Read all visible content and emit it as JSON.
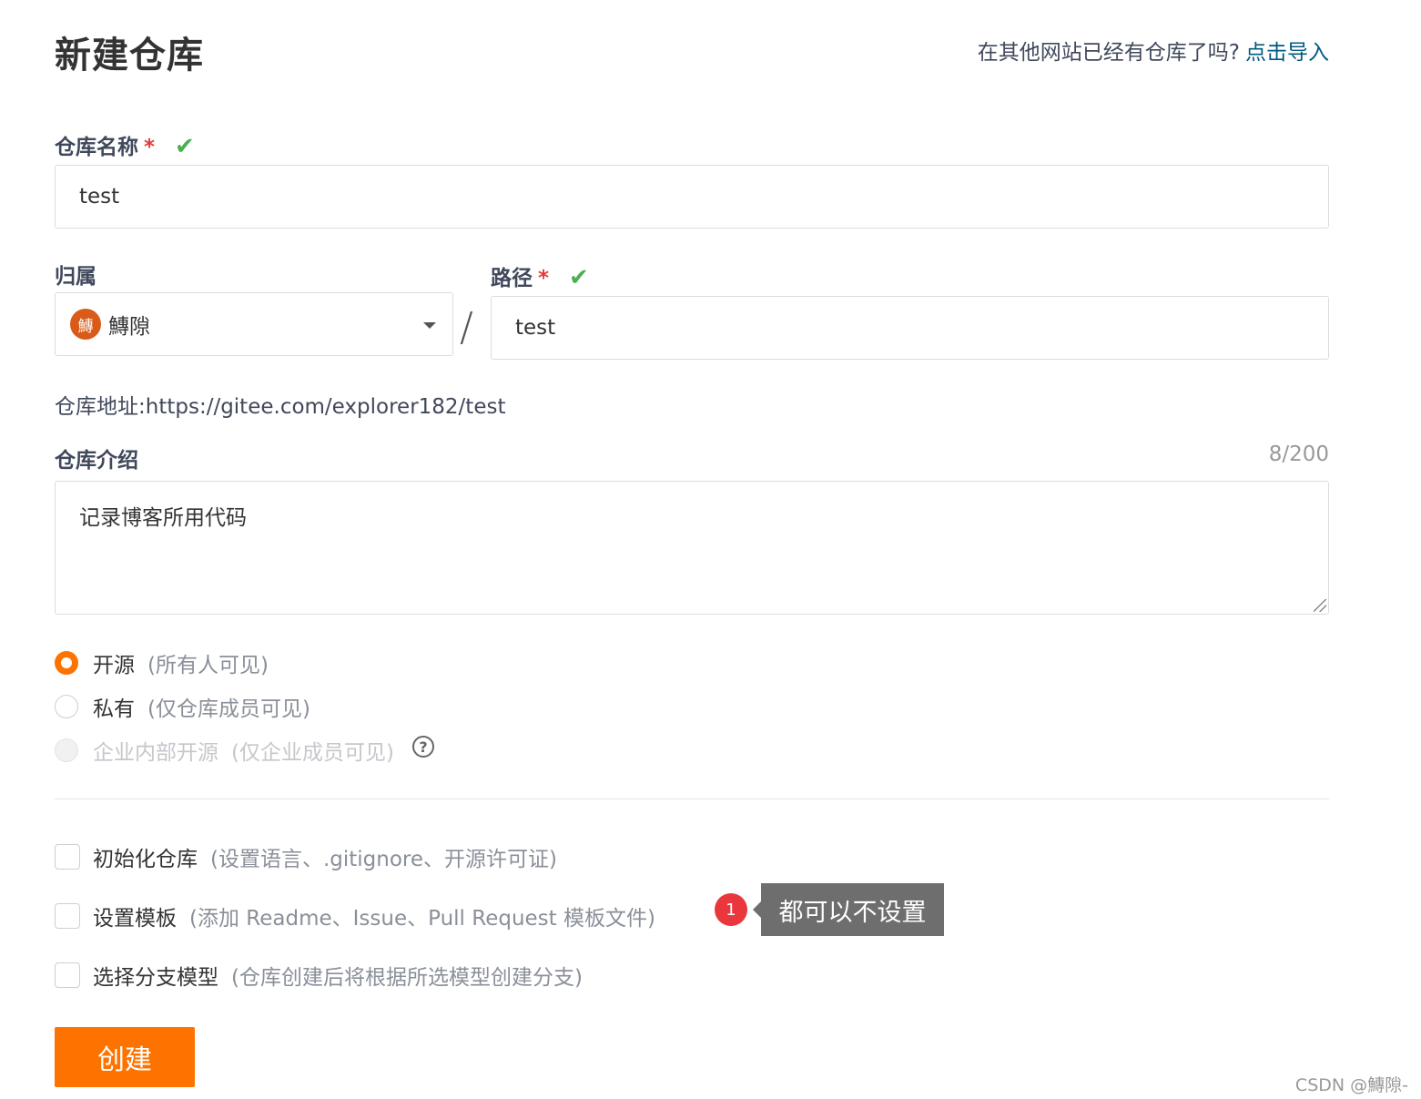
{
  "header": {
    "title": "新建仓库",
    "import_prompt": "在其他网站已经有仓库了吗?",
    "import_link": "点击导入"
  },
  "repo_name": {
    "label": "仓库名称",
    "required_mark": "*",
    "valid_icon": "✔",
    "value": "test"
  },
  "owner": {
    "label": "归属",
    "avatar_char": "鱄",
    "value": "鱄隙",
    "caret_icon": "chevron-down-icon"
  },
  "separator": "/",
  "path": {
    "label": "路径",
    "required_mark": "*",
    "valid_icon": "✔",
    "value": "test"
  },
  "repo_url": {
    "label": "仓库地址:",
    "value": "https://gitee.com/explorer182/test"
  },
  "description": {
    "label": "仓库介绍",
    "counter": "8/200",
    "value": "记录博客所用代码"
  },
  "visibility": {
    "selected": "public",
    "options": [
      {
        "label": "开源",
        "hint": "(所有人可见)"
      },
      {
        "label": "私有",
        "hint": "(仅仓库成员可见)"
      },
      {
        "label": "企业内部开源",
        "hint": "(仅企业成员可见)",
        "help_icon": "?"
      }
    ]
  },
  "extras": [
    {
      "label": "初始化仓库",
      "hint": "(设置语言、.gitignore、开源许可证)"
    },
    {
      "label": "设置模板",
      "hint": "(添加 Readme、Issue、Pull Request 模板文件)"
    },
    {
      "label": "选择分支模型",
      "hint": "(仓库创建后将根据所选模型创建分支)"
    }
  ],
  "annotation": {
    "badge": "1",
    "text": "都可以不设置"
  },
  "submit_label": "创建",
  "watermark": "CSDN @鱄隙-",
  "colors": {
    "accent": "#fe7300",
    "link": "#005980",
    "valid": "#4caf50",
    "required": "#e33c3c",
    "badge": "#e9373d"
  }
}
